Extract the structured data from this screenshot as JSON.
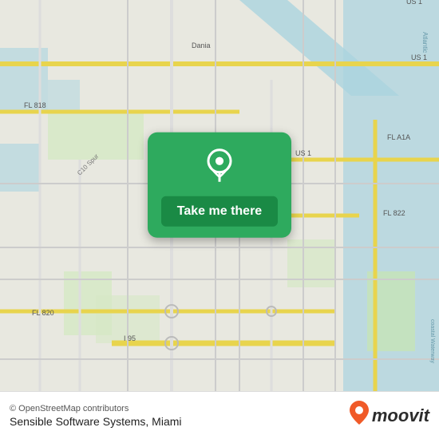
{
  "map": {
    "copyright": "© OpenStreetMap contributors",
    "background_color": "#e8e0d8"
  },
  "button": {
    "label": "Take me there",
    "pin_color": "#ffffff",
    "card_color": "#2eaa5e"
  },
  "bottom_bar": {
    "copyright": "© OpenStreetMap contributors",
    "company": "Sensible Software Systems, Miami",
    "moovit_label": "moovit"
  }
}
